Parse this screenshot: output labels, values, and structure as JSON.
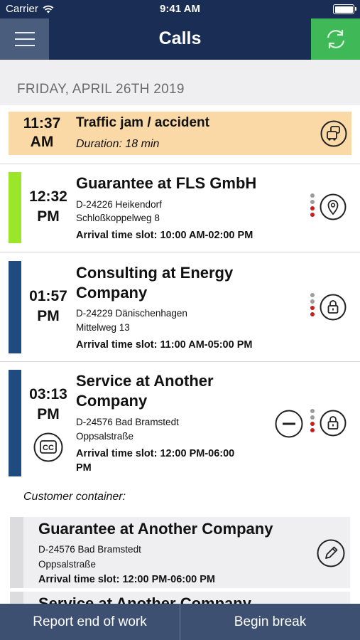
{
  "status_bar": {
    "carrier": "Carrier",
    "time": "9:41 AM"
  },
  "nav": {
    "title": "Calls"
  },
  "date_header": "FRIDAY, APRIL 26TH 2019",
  "traffic": {
    "time": "11:37",
    "ampm": "AM",
    "title": "Traffic jam / accident",
    "duration": "Duration: 18 min",
    "icon": "traffic-jam-icon"
  },
  "calls": [
    {
      "time": "12:32",
      "ampm": "PM",
      "title": "Guarantee at FLS GmbH",
      "address_line1": "D-24226 Heikendorf",
      "address_line2": "Schloßkoppelweg 8",
      "slot": "Arrival time slot: 10:00 AM-02:00 PM",
      "bar_color": "#9be52a",
      "icon": "map-pin-icon"
    },
    {
      "time": "01:57",
      "ampm": "PM",
      "title_line1": "Consulting at Energy",
      "title_line2": "Company",
      "address_line1": "D-24229 Dänischenhagen",
      "address_line2": "Mittelweg 13",
      "slot": "Arrival time slot: 11:00 AM-05:00 PM",
      "bar_color": "#1f4b7e",
      "icon": "lock-icon"
    },
    {
      "time": "03:13",
      "ampm": "PM",
      "title_line1": "Service at Another",
      "title_line2": "Company",
      "address_line1": "D-24576 Bad Bramstedt",
      "address_line2": "Oppsalstraße",
      "slot_line1": "Arrival time slot: 12:00 PM-06:00",
      "slot_line2": "PM",
      "bar_color": "#1f4b7e",
      "badge": "CC",
      "icons": [
        "collapse-minus-icon",
        "lock-icon"
      ]
    }
  ],
  "customer_container": {
    "label": "Customer container:",
    "items": [
      {
        "title": "Guarantee at Another Company",
        "address_line1": "D-24576 Bad Bramstedt",
        "address_line2": "Oppsalstraße",
        "slot": "Arrival time slot: 12:00 PM-06:00 PM",
        "icon": "edit-pencil-icon"
      },
      {
        "title": "Service at Another Company"
      }
    ]
  },
  "bottom_bar": {
    "report": "Report end of work",
    "break": "Begin break"
  }
}
